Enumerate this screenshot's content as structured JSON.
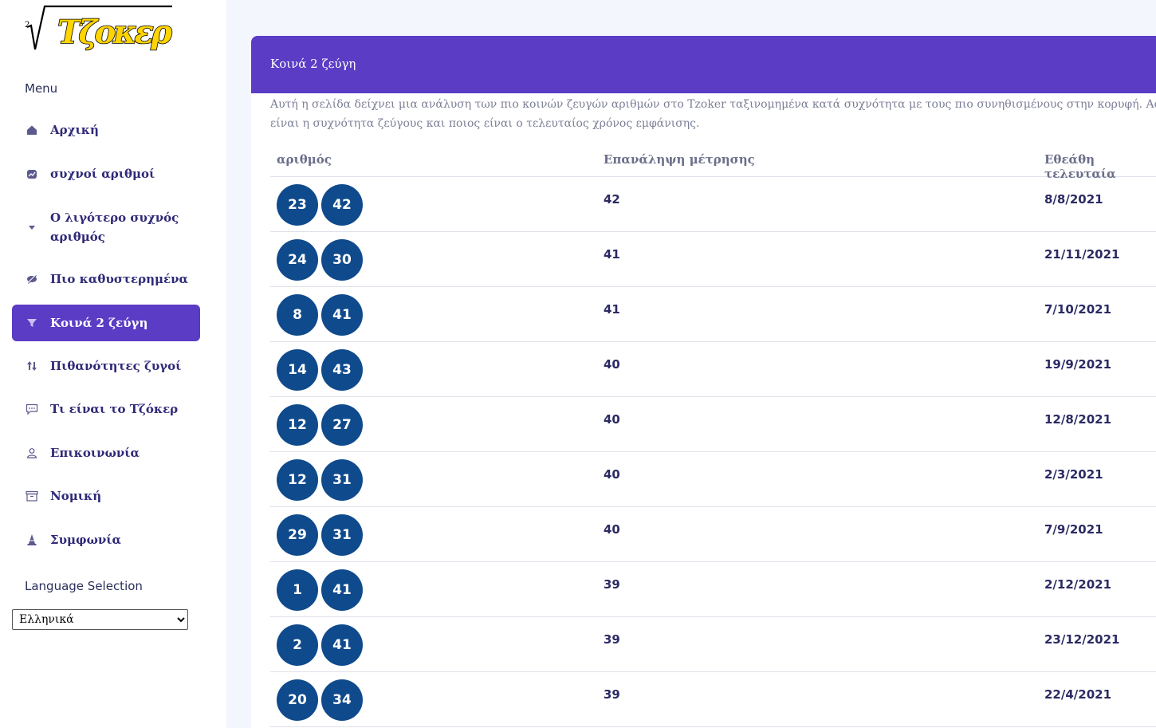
{
  "logo": {
    "exponent": "2",
    "text": "Τζοκερ"
  },
  "sidebar": {
    "menu_heading": "Menu",
    "items": [
      {
        "label": "Αρχική",
        "icon": "home-icon",
        "active": false
      },
      {
        "label": "συχνοί αριθμοί",
        "icon": "chart-icon",
        "active": false
      },
      {
        "label": "Ο λιγότερο συχνός αριθμός",
        "icon": "chevron-down-icon",
        "active": false
      },
      {
        "label": "Πιο καθυστερημένα",
        "icon": "eye-slash-icon",
        "active": false
      },
      {
        "label": "Κοινά 2 ζεύγη",
        "icon": "filter-icon",
        "active": true
      },
      {
        "label": "Πιθανότητες ζυγοί",
        "icon": "sort-arrows-icon",
        "active": false
      },
      {
        "label": "Τι είναι το Τζόκερ",
        "icon": "chat-icon",
        "active": false
      },
      {
        "label": "Επικοινωνία",
        "icon": "user-icon",
        "active": false
      },
      {
        "label": "Νομική",
        "icon": "archive-icon",
        "active": false
      },
      {
        "label": "Συμφωνία",
        "icon": "cone-icon",
        "active": false
      }
    ],
    "language_heading": "Language Selection",
    "language_selected": "Ελληνικά"
  },
  "main": {
    "title": "Κοινά 2 ζεύγη",
    "intro_line1": "Αυτή η σελίδα δείχνει μια ανάλυση των πιο κοινών ζευγών αριθμών στο Tzoker ταξινομημένα κατά συχνότητα με τους πιο συνηθισμένους στην κορυφή. Ας δούμε τον παρ",
    "intro_line2": "είναι η συχνότητα ζεύγους και ποιος είναι ο τελευταίος χρόνος εμφάνισης.",
    "columns": [
      "αριθμός",
      "Επανάληψη μέτρησης",
      "Εθεάθη τελευταία"
    ],
    "rows": [
      {
        "n1": "23",
        "n2": "42",
        "count": "42",
        "last": "8/8/2021"
      },
      {
        "n1": "24",
        "n2": "30",
        "count": "41",
        "last": "21/11/2021"
      },
      {
        "n1": "8",
        "n2": "41",
        "count": "41",
        "last": "7/10/2021"
      },
      {
        "n1": "14",
        "n2": "43",
        "count": "40",
        "last": "19/9/2021"
      },
      {
        "n1": "12",
        "n2": "27",
        "count": "40",
        "last": "12/8/2021"
      },
      {
        "n1": "12",
        "n2": "31",
        "count": "40",
        "last": "2/3/2021"
      },
      {
        "n1": "29",
        "n2": "31",
        "count": "40",
        "last": "7/9/2021"
      },
      {
        "n1": "1",
        "n2": "41",
        "count": "39",
        "last": "2/12/2021"
      },
      {
        "n1": "2",
        "n2": "41",
        "count": "39",
        "last": "23/12/2021"
      },
      {
        "n1": "20",
        "n2": "34",
        "count": "39",
        "last": "22/4/2021"
      }
    ]
  },
  "colors": {
    "accent": "#5a3cc5",
    "ball": "#0f4a8c",
    "page_bg": "#f3f6fd",
    "nav_text": "#302a78"
  }
}
